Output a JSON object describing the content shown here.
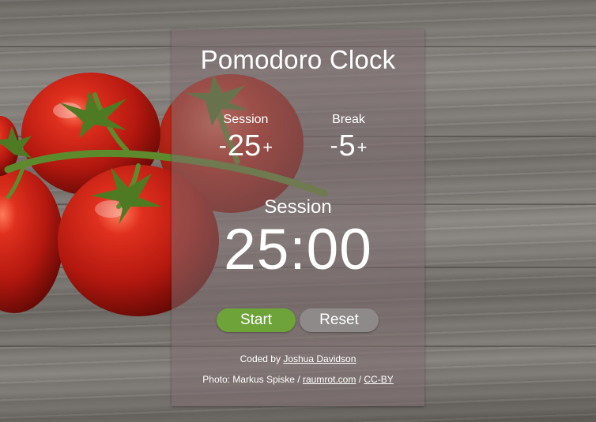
{
  "app": {
    "title": "Pomodoro Clock"
  },
  "settings": {
    "session": {
      "label": "Session",
      "value": "25",
      "decrement": "-",
      "increment": "+"
    },
    "break": {
      "label": "Break",
      "value": "5",
      "decrement": "-",
      "increment": "+"
    }
  },
  "timer": {
    "mode": "Session",
    "display": "25:00"
  },
  "controls": {
    "start_label": "Start",
    "reset_label": "Reset"
  },
  "credits": {
    "coded_prefix": "Coded by",
    "coder_link": "Joshua Davidson",
    "photo_prefix": "Photo: Markus Spiske /",
    "site_link": "raumrot.com",
    "separator": "/",
    "license_link": "CC-BY"
  },
  "colors": {
    "start_button": "#6ea33a",
    "reset_button": "#8f8a8a",
    "panel": "#7d6e70",
    "text": "#ffffff"
  },
  "background": {
    "subject": "tomatoes-on-vine-on-wooden-table"
  }
}
